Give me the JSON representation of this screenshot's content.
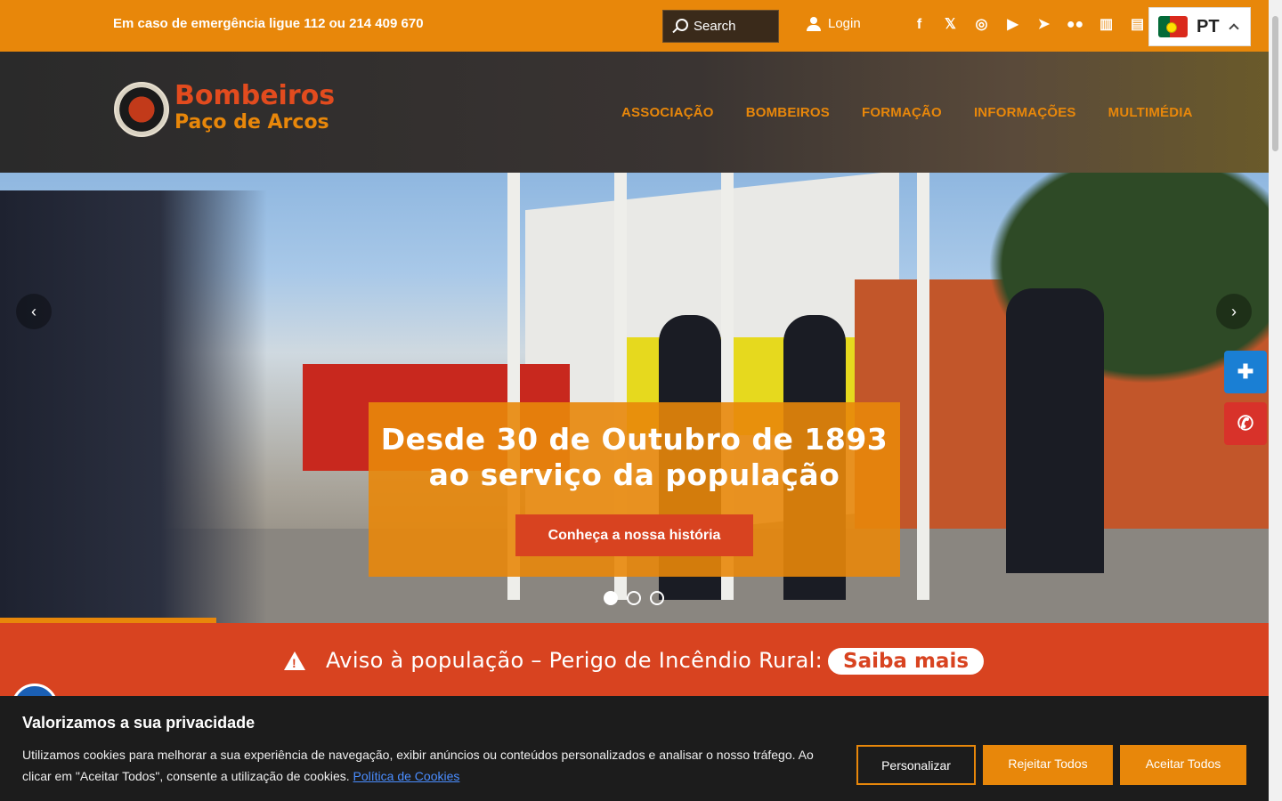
{
  "topbar": {
    "emergency": "Em caso de emergência ligue 112 ou 214 409 670",
    "search_placeholder": "Search",
    "login": "Login",
    "social_icons": [
      "facebook-icon",
      "x-icon",
      "instagram-icon",
      "youtube-icon",
      "telegram-icon",
      "flickr-icon",
      "book-icon",
      "document-icon"
    ],
    "language": "PT"
  },
  "header": {
    "logo_line1": "Bombeiros",
    "logo_line2": "Paço de Arcos",
    "nav": [
      "ASSOCIAÇÃO",
      "BOMBEIROS",
      "FORMAÇÃO",
      "INFORMAÇÕES",
      "MULTIMÉDIA"
    ]
  },
  "hero": {
    "title_line1": "Desde 30 de Outubro de 1893",
    "title_line2": "ao serviço da população",
    "cta": "Conheça a nossa história",
    "slides": 3,
    "active_slide": 1
  },
  "alert": {
    "text": "Aviso à população – Perigo de Incêndio Rural:",
    "link": "Saiba mais"
  },
  "cookie": {
    "title": "Valorizamos a sua privacidade",
    "body": "Utilizamos cookies para melhorar a sua experiência de navegação, exibir anúncios ou conteúdos personalizados e analisar o nosso tráfego. Ao clicar em \"Aceitar Todos\", consente a utilização de cookies.",
    "policy_link": "Política de Cookies",
    "customize": "Personalizar",
    "reject": "Rejeitar Todos",
    "accept": "Aceitar Todos"
  },
  "colors": {
    "brand_orange": "#e8870a",
    "brand_red": "#d84320",
    "dark": "#1c1c1c"
  }
}
